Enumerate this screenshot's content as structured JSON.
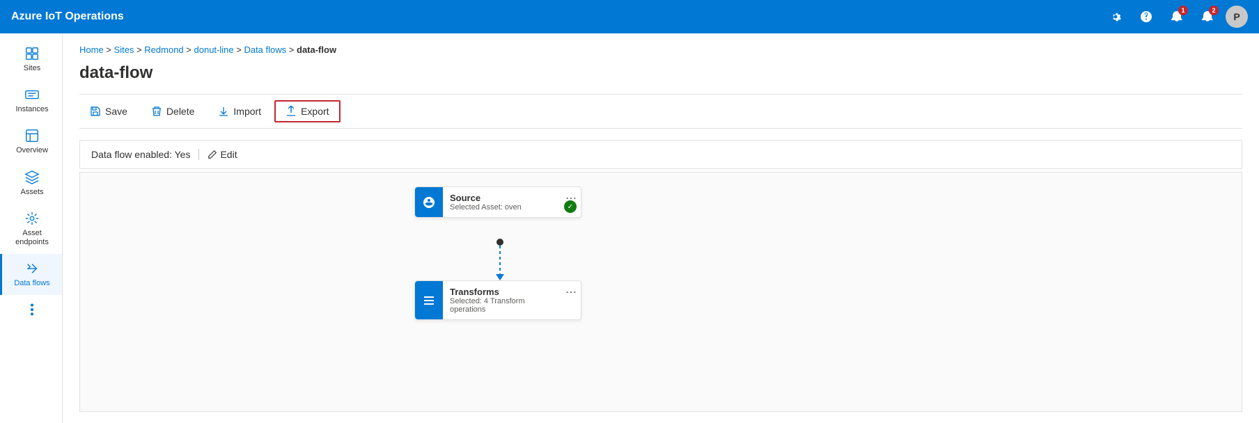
{
  "app": {
    "title": "Azure IoT Operations"
  },
  "topnav": {
    "settings_label": "Settings",
    "help_label": "Help",
    "alerts1_label": "Alerts",
    "alerts1_count": "1",
    "alerts2_label": "Notifications",
    "alerts2_count": "2",
    "avatar_label": "P"
  },
  "sidebar": {
    "items": [
      {
        "id": "sites",
        "label": "Sites",
        "active": false
      },
      {
        "id": "instances",
        "label": "Instances",
        "active": false
      },
      {
        "id": "overview",
        "label": "Overview",
        "active": false
      },
      {
        "id": "assets",
        "label": "Assets",
        "active": false
      },
      {
        "id": "asset-endpoints",
        "label": "Asset endpoints",
        "active": false
      },
      {
        "id": "data-flows",
        "label": "Data flows",
        "active": true
      },
      {
        "id": "more",
        "label": "",
        "active": false
      }
    ]
  },
  "breadcrumb": {
    "parts": [
      "Home",
      "Sites",
      "Redmond",
      "donut-line",
      "Data flows"
    ],
    "current": "data-flow",
    "separator": " > "
  },
  "page": {
    "title": "data-flow"
  },
  "toolbar": {
    "save_label": "Save",
    "delete_label": "Delete",
    "import_label": "Import",
    "export_label": "Export"
  },
  "status": {
    "enabled_label": "Data flow enabled: Yes",
    "edit_label": "Edit"
  },
  "flow": {
    "source_node": {
      "title": "Source",
      "subtitle": "Selected Asset: oven",
      "status": "ok"
    },
    "transforms_node": {
      "title": "Transforms",
      "subtitle": "Selected: 4 Transform operations"
    }
  }
}
